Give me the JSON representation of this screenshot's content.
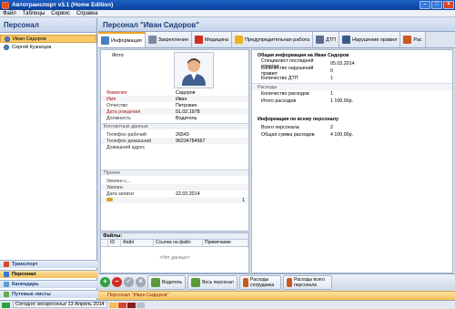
{
  "app": {
    "title": "Автотранспорт v3.1 (Home Edition)"
  },
  "menu": [
    "Файл",
    "Таблицы",
    "Сервис",
    "Справка"
  ],
  "left": {
    "header": "Персонал",
    "people": [
      {
        "name": "Иван Сидоров",
        "selected": true
      },
      {
        "name": "Сергей Кузнецов",
        "selected": false
      }
    ],
    "nav": [
      {
        "label": "Транспорт",
        "icon": "car-icon"
      },
      {
        "label": "Персонал",
        "icon": "people-icon"
      },
      {
        "label": "Календарь",
        "icon": "calendar-icon"
      },
      {
        "label": "Путевые листы",
        "icon": "document-icon"
      }
    ]
  },
  "main": {
    "header": "Персонал \"Иван Сидоров\"",
    "tabs": [
      {
        "label": "Информация",
        "icon": "info-icon"
      },
      {
        "label": "Закрепления",
        "icon": "car-icon"
      },
      {
        "label": "Медицина",
        "icon": "medical-icon"
      },
      {
        "label": "Предупредительная работа",
        "icon": "warning-icon"
      },
      {
        "label": "ДТП",
        "icon": "accident-icon"
      },
      {
        "label": "Нарушение правил",
        "icon": "violation-icon"
      },
      {
        "label": "Рас",
        "icon": "expense-icon"
      }
    ]
  },
  "info": {
    "photo_label": "Фото",
    "fields": [
      {
        "label": "Фамилия",
        "value": "Сидоров"
      },
      {
        "label": "Имя",
        "value": "Иван"
      },
      {
        "label": "Отчество",
        "value": "Петрович"
      },
      {
        "label": "Дата рождения",
        "value": "01.02.1978"
      },
      {
        "label": "Должность",
        "value": "Водитель"
      }
    ],
    "contacts_group": "Контактные данные",
    "contacts": [
      {
        "label": "Телефон рабочий",
        "value": "26543"
      },
      {
        "label": "Телефон домашний",
        "value": "96234784567"
      },
      {
        "label": "Домашний адрес",
        "value": ""
      }
    ],
    "other_group": "Прочее",
    "other": [
      {
        "label": "Уволен с...",
        "value": ""
      },
      {
        "label": "Уволен",
        "value": ""
      },
      {
        "label": "Дата записи",
        "value": "22.03.2014"
      },
      {
        "label": "",
        "value": "1"
      }
    ]
  },
  "files": {
    "title": "Файлы:",
    "columns": [
      "ID",
      "Файл",
      "Ссылка на файл",
      "Примечание"
    ],
    "empty_text": "<Нет данных>"
  },
  "general": {
    "title": "Общая информация на Иван Сидоров",
    "rows": [
      {
        "label": "Специалист последней отметки",
        "value": "05.03.2014"
      },
      {
        "label": "Количество нарушений правил",
        "value": "0"
      },
      {
        "label": "Количество ДТП",
        "value": "1"
      }
    ],
    "expenses_head": "Расходы",
    "expense_rows": [
      {
        "label": "Количество расходов",
        "value": "1"
      },
      {
        "label": "Итого расходов",
        "value": "1 100,00р."
      }
    ],
    "all_title": "Информация по всему персоналу",
    "all_rows": [
      {
        "label": "Всего персонала",
        "value": "2"
      },
      {
        "label": "Общая сумма расходов",
        "value": "4 100,00р."
      }
    ]
  },
  "toolbar": {
    "buttons": [
      {
        "label": "Водитель",
        "icon": "driver-icon"
      },
      {
        "label": "Весь персонал",
        "icon": "all-people-icon"
      },
      {
        "label": "Расходы сотрудника",
        "icon": "employee-expenses-icon"
      },
      {
        "label": "Расходы всего персонала",
        "icon": "all-expenses-icon"
      }
    ]
  },
  "selection": "Персонал \"Иван Сидоров\"",
  "status": {
    "date_text": "Сегодня: воскресенье 13 Апрель 2014"
  },
  "colors": {
    "accent": "#f5bf55",
    "header_text": "#1d3c78",
    "add": "#2ea043",
    "delete": "#d03020"
  }
}
